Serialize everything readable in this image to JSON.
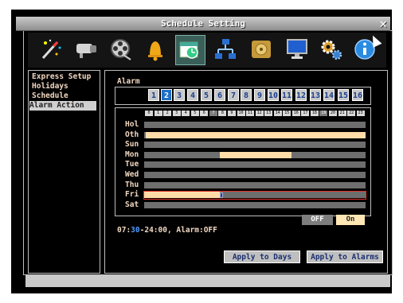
{
  "window": {
    "title": "Schedule Setting",
    "close_glyph": "✕"
  },
  "toolbar": {
    "icons": [
      "magic-wand-icon",
      "camera-icon",
      "film-reel-icon",
      "bell-icon",
      "schedule-icon",
      "network-icon",
      "harddisk-icon",
      "monitor-icon",
      "gears-icon",
      "info-icon"
    ],
    "selected": "schedule-icon"
  },
  "sidebar": {
    "items": [
      "Express Setup",
      "Holidays",
      "Schedule",
      "Alarm Action"
    ],
    "active_index": 3
  },
  "alarm": {
    "label": "Alarm",
    "numbers": [
      "1",
      "2",
      "3",
      "4",
      "5",
      "6",
      "7",
      "8",
      "9",
      "10",
      "11",
      "12",
      "13",
      "14",
      "15",
      "16"
    ],
    "selected": "2"
  },
  "hours": [
    "0",
    "1",
    "2",
    "3",
    "4",
    "5",
    "6",
    "7",
    "8",
    "9",
    "10",
    "11",
    "12",
    "13",
    "14",
    "15",
    "16",
    "17",
    "18",
    "19",
    "20",
    "21",
    "22",
    "23"
  ],
  "highlight_hours": [
    "7",
    "19"
  ],
  "days": [
    "Hol",
    "Oth",
    "Sun",
    "Mon",
    "Tue",
    "Wed",
    "Thu",
    "Fri",
    "Sat"
  ],
  "schedule": {
    "Hol": [],
    "Oth": [
      [
        0.2,
        24
      ]
    ],
    "Sun": [],
    "Mon": [
      [
        8.2,
        16
      ]
    ],
    "Tue": [],
    "Wed": [],
    "Thu": [],
    "Fri": [
      [
        0,
        8.2
      ]
    ],
    "Sat": []
  },
  "colors": {
    "on": "#ffdca8",
    "off": "#6e6e6e",
    "accent": "#1f6fc5"
  },
  "toggle": {
    "off_label": "OFF",
    "on_label": "On"
  },
  "status": {
    "time_start": "07:",
    "time_blue": "30",
    "time_rest": "-24:00, Alarm:OFF"
  },
  "buttons": {
    "apply_days": "Apply to Days",
    "apply_alarms": "Apply to Alarms"
  }
}
